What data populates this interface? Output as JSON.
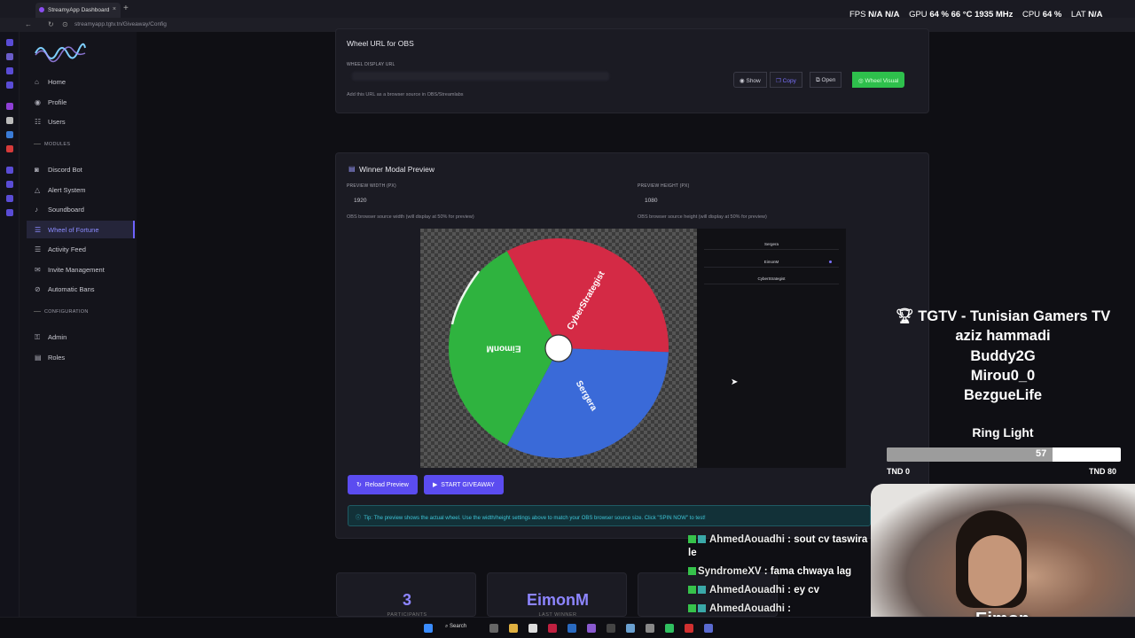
{
  "browser": {
    "tab_title": "StreamyApp Dashboard",
    "close_glyph": "×",
    "new_tab_glyph": "+",
    "address": "streamyapp.tgtv.tn/Giveaway/Config"
  },
  "overlay_stats": {
    "fps_label": "FPS",
    "fps_value": "N/A",
    "fps_value2": "N/A",
    "gpu_label": "GPU",
    "gpu_value": "64 %  66 °C  1935 MHz",
    "cpu_label": "CPU",
    "cpu_value": "64 %",
    "lat_label": "LAT",
    "lat_value": "N/A"
  },
  "sidebar": {
    "items": [
      {
        "label": "Home",
        "icon": "home-icon",
        "glyph": "⌂"
      },
      {
        "label": "Profile",
        "icon": "user-icon",
        "glyph": "◉"
      },
      {
        "label": "Users",
        "icon": "users-icon",
        "glyph": "☷"
      }
    ],
    "modules_heading": "MODULES",
    "modules": [
      {
        "label": "Discord Bot",
        "icon": "discord-icon",
        "glyph": "◙"
      },
      {
        "label": "Alert System",
        "icon": "bell-icon",
        "glyph": "△"
      },
      {
        "label": "Soundboard",
        "icon": "sound-icon",
        "glyph": "♪"
      },
      {
        "label": "Wheel of Fortune",
        "icon": "list-icon",
        "glyph": "☰"
      },
      {
        "label": "Activity Feed",
        "icon": "feed-icon",
        "glyph": "☰"
      },
      {
        "label": "Invite Management",
        "icon": "envelope-icon",
        "glyph": "✉"
      },
      {
        "label": "Automatic Bans",
        "icon": "ban-icon",
        "glyph": "⊘"
      }
    ],
    "config_heading": "CONFIGURATION",
    "config": [
      {
        "label": "Admin",
        "icon": "key-icon",
        "glyph": "⚿"
      },
      {
        "label": "Roles",
        "icon": "doc-icon",
        "glyph": "▤"
      }
    ]
  },
  "obs_card": {
    "title": "Wheel URL for OBS",
    "field_label": "WHEEL DISPLAY URL",
    "help": "Add this URL as a browser source in OBS/Streamlabs",
    "buttons": {
      "show": "Show",
      "copy": "Copy",
      "open": "Open",
      "wheel": "Wheel Visual"
    }
  },
  "preview_card": {
    "title": "Winner Modal Preview",
    "width_label": "PREVIEW WIDTH (PX)",
    "width_value": "1920",
    "width_help": "OBS browser source width (will display at 50% for preview)",
    "height_label": "PREVIEW HEIGHT (PX)",
    "height_value": "1080",
    "height_help": "OBS browser source height (will display at 50% for preview)",
    "wheel_segments": [
      {
        "name": "CyberStrategist",
        "color": "#d42a45"
      },
      {
        "name": "Sergera",
        "color": "#3a6ad8"
      },
      {
        "name": "EimonM",
        "color": "#2fb33f"
      }
    ],
    "participants": [
      "Sergera",
      "EimonM",
      "CyberStrategist"
    ],
    "reload_button": "Reload Preview",
    "start_button": "START GIVEAWAY",
    "tip": "Tip: The preview shows the actual wheel. Use the width/height settings above to match your OBS browser source size. Click \"SPIN NOW\" to test!"
  },
  "stats": [
    {
      "value": "3",
      "label": "PARTICIPANTS"
    },
    {
      "value": "EimonM",
      "label": "LAST WINNER"
    }
  ],
  "stream_overlay": {
    "donors": [
      "TGTV - Tunisian Gamers TV",
      "aziz hammadi",
      "Buddy2G",
      "Mirou0_0",
      "BezgueLife"
    ],
    "goal_name": "Ring Light",
    "goal_value": "57",
    "goal_min": "TND 0",
    "goal_max": "TND 80",
    "goal_progress": 0.71,
    "cam_name": "Eimon"
  },
  "chat": [
    {
      "user": "AhmedAouadhi",
      "text": ": sout cv taswira le"
    },
    {
      "user": "SyndromeXV",
      "text": ": fama chwaya lag"
    },
    {
      "user": "AhmedAouadhi",
      "text": ": ey cv"
    },
    {
      "user": "AhmedAouadhi",
      "text": ":"
    }
  ],
  "taskbar": {
    "search": "Search"
  }
}
